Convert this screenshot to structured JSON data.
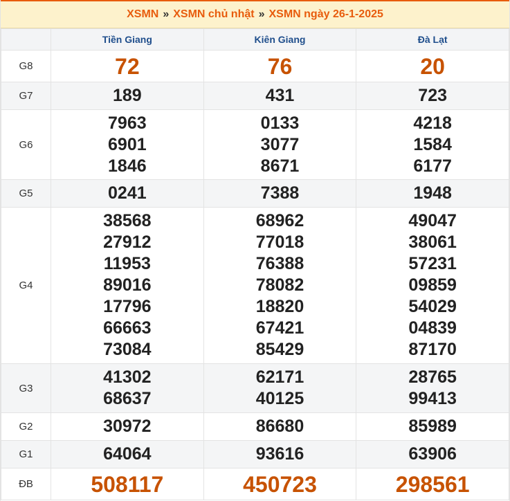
{
  "breadcrumb": {
    "home": "XSMN",
    "day": "XSMN chủ nhật",
    "current": "XSMN ngày 26-1-2025",
    "separator": "»"
  },
  "provinces": [
    "Tiền Giang",
    "Kiên Giang",
    "Đà Lạt"
  ],
  "prizes": [
    {
      "label": "G8",
      "values": [
        [
          "72"
        ],
        [
          "76"
        ],
        [
          "20"
        ]
      ]
    },
    {
      "label": "G7",
      "values": [
        [
          "189"
        ],
        [
          "431"
        ],
        [
          "723"
        ]
      ]
    },
    {
      "label": "G6",
      "values": [
        [
          "7963",
          "6901",
          "1846"
        ],
        [
          "0133",
          "3077",
          "8671"
        ],
        [
          "4218",
          "1584",
          "6177"
        ]
      ]
    },
    {
      "label": "G5",
      "values": [
        [
          "0241"
        ],
        [
          "7388"
        ],
        [
          "1948"
        ]
      ]
    },
    {
      "label": "G4",
      "values": [
        [
          "38568",
          "27912",
          "11953",
          "89016",
          "17796",
          "66663",
          "73084"
        ],
        [
          "68962",
          "77018",
          "76388",
          "78082",
          "18820",
          "67421",
          "85429"
        ],
        [
          "49047",
          "38061",
          "57231",
          "09859",
          "54029",
          "04839",
          "87170"
        ]
      ]
    },
    {
      "label": "G3",
      "values": [
        [
          "41302",
          "68637"
        ],
        [
          "62171",
          "40125"
        ],
        [
          "28765",
          "99413"
        ]
      ]
    },
    {
      "label": "G2",
      "values": [
        [
          "30972"
        ],
        [
          "86680"
        ],
        [
          "85989"
        ]
      ]
    },
    {
      "label": "G1",
      "values": [
        [
          "64064"
        ],
        [
          "93616"
        ],
        [
          "63906"
        ]
      ]
    },
    {
      "label": "ĐB",
      "values": [
        [
          "508117"
        ],
        [
          "450723"
        ],
        [
          "298561"
        ]
      ]
    }
  ],
  "colors": {
    "accent": "#e85c0d",
    "special": "#c75200",
    "province": "#1f4e8c",
    "title_bg": "#fdf2cc"
  }
}
